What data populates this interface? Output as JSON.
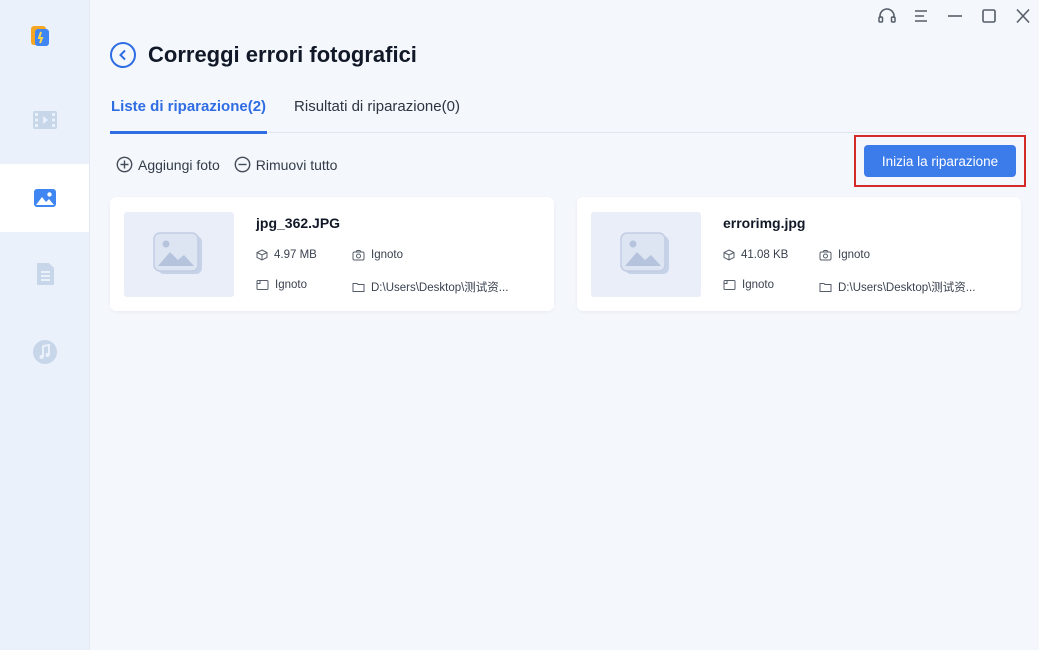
{
  "page": {
    "title": "Correggi errori fotografici"
  },
  "sidebar": {
    "items": [
      {
        "icon": "video-icon",
        "active": false
      },
      {
        "icon": "photo-icon",
        "active": true
      },
      {
        "icon": "document-icon",
        "active": false
      },
      {
        "icon": "music-icon",
        "active": false
      }
    ]
  },
  "window_controls": [
    "headset-icon",
    "menu-icon",
    "minimize-icon",
    "maximize-icon",
    "close-icon"
  ],
  "tabs": [
    {
      "label": "Liste di riparazione(2)",
      "active": true
    },
    {
      "label": "Risultati di riparazione(0)",
      "active": false
    }
  ],
  "toolbar": {
    "add_label": "Aggiungi foto",
    "remove_label": "Rimuovi tutto",
    "start_label": "Inizia la riparazione"
  },
  "files": [
    {
      "name": "jpg_362.JPG",
      "size": "4.97 MB",
      "camera": "Ignoto",
      "resolution": "Ignoto",
      "path": "D:\\Users\\Desktop\\测试资..."
    },
    {
      "name": "errorimg.jpg",
      "size": "41.08 KB",
      "camera": "Ignoto",
      "resolution": "Ignoto",
      "path": "D:\\Users\\Desktop\\测试资..."
    }
  ],
  "colors": {
    "accent": "#2f6de3",
    "button": "#3b7bea",
    "highlight_box": "#d42a2a",
    "sidebar_bg": "#eaf1fb",
    "content_bg": "#f4f7fc"
  }
}
